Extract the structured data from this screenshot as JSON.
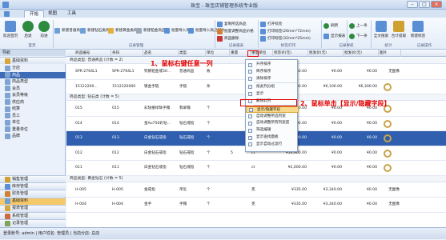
{
  "window": {
    "title": "珠宝 - 珠宝店铺管理系统专业版"
  },
  "tabs": [
    "开始",
    "视图",
    "工具"
  ],
  "ribbon": {
    "big_buttons": [
      {
        "label": "欢迎首页",
        "color": "#5a8fd6"
      },
      {
        "label": "后退",
        "color": "#2e8b3e"
      },
      {
        "label": "前进",
        "color": "#2e8b3e"
      }
    ],
    "buttons": [
      {
        "label": "新建普通商品",
        "color": "#6ea0d8"
      },
      {
        "label": "新建钻石类商品",
        "color": "#6ea0d8"
      },
      {
        "label": "新建黄金类商品",
        "color": "#e0b040"
      },
      {
        "label": "新建铂金商品",
        "color": "#9aa8b8"
      },
      {
        "label": "批量导入商品",
        "color": "#5a8fd6"
      },
      {
        "label": "批量导入商品图片",
        "color": "#5a8fd6"
      },
      {
        "label": "复制所选商品",
        "color": "#5a8fd6"
      },
      {
        "label": "批量调整商品价格",
        "color": "#d08030"
      },
      {
        "label": "商品删除",
        "color": "#cc3333"
      },
      {
        "label": "打开标签",
        "color": "#5a8fd6"
      },
      {
        "label": "打印标签(26mm*72mm)",
        "color": "#5a8fd6"
      },
      {
        "label": "打印标签(32mm*25mm)",
        "color": "#5a8fd6"
      },
      {
        "label": "刷新",
        "color": "#2e8b3e"
      },
      {
        "label": "显示报表",
        "color": "#5a8fd6"
      },
      {
        "label": "上一条",
        "color": "#2e8b3e"
      },
      {
        "label": "下一条",
        "color": "#2e8b3e"
      },
      {
        "label": "全文搜索",
        "color": "#5a8fd6"
      },
      {
        "label": "合计提取",
        "color": "#d0a030"
      },
      {
        "label": "新建标签",
        "color": "#5a8fd6"
      }
    ],
    "groups": [
      "首页",
      "记录管理",
      "记录报表",
      "标签打印",
      "记录导航",
      "统计",
      "记录操作"
    ]
  },
  "nav": {
    "header": "导航",
    "section": "基础资料",
    "items": [
      "分店",
      "商品",
      "商品类型",
      "会员",
      "会员等级",
      "供应商",
      "结算",
      "员工",
      "单位",
      "重量单位",
      "品牌"
    ],
    "selected_index": 1,
    "groups": [
      "销售管理",
      "库存管理",
      "财务管理",
      "基础资料",
      "报表管理",
      "系统管理",
      "记录管理"
    ]
  },
  "grid": {
    "columns": [
      "商品编号",
      "条码",
      "品名",
      "类型",
      "单位",
      "重量",
      "重量单位",
      "标签价(元)",
      "批发价(元)",
      "批发价(元)",
      "图片"
    ],
    "groups": [
      {
        "label": "商品类型: 普通商品 (计数 = 2)",
        "rows": [
          {
            "no": "SPR-2764L1",
            "barcode": "SPR-2764L1",
            "name": "钨钢铂金戒50...",
            "type": "普通商品",
            "unit": "枚",
            "weight": "",
            "wunit": "",
            "tag": "¥150.00",
            "wholesale1": "¥0.00",
            "wholesale2": "¥0.00",
            "pic": "无图像"
          },
          {
            "no": "15122200...",
            "barcode": "1512220000",
            "name": "镀金手链",
            "type": "手链",
            "unit": "条",
            "weight": "",
            "wunit": "",
            "tag": "¥6,300.00",
            "wholesale1": "¥6,100.00",
            "wholesale2": "¥6,300.00",
            "pic": "ring"
          }
        ]
      },
      {
        "label": "商品类型: 钻石类 (计数 = 5)",
        "rows": [
          {
            "no": "015",
            "barcode": "015",
            "name": "彩珐璧绿珠手镯",
            "type": "翡翠镯",
            "unit": "个",
            "weight": "",
            "wunit": "ct",
            "tag": "¥2,400.00",
            "wholesale1": "¥0.00",
            "wholesale2": "¥0.00",
            "pic": "ring"
          },
          {
            "no": "014",
            "barcode": "014",
            "name": "金Au750彩钻...",
            "type": "钻石戒指",
            "unit": "个",
            "weight": "",
            "wunit": "ct",
            "tag": "¥3,000.00",
            "wholesale1": "¥0.00",
            "wholesale2": "¥0.00",
            "pic": "ring"
          },
          {
            "no": "013",
            "barcode": "013",
            "name": "白金钻石戒指",
            "type": "钻石戒指",
            "unit": "个",
            "weight": "",
            "wunit": "ct",
            "tag": "¥2,000.00",
            "wholesale1": "¥0.00",
            "wholesale2": "¥0.00",
            "pic": "ring",
            "selected": true
          },
          {
            "no": "012",
            "barcode": "012",
            "name": "白金钻石戒指",
            "type": "钻石戒指",
            "unit": "个",
            "weight": "5",
            "wunit": "ct",
            "tag": "¥16,900.00",
            "wholesale1": "¥0.00",
            "wholesale2": "¥0.00",
            "pic": "ring"
          },
          {
            "no": "011",
            "barcode": "011",
            "name": "白金钻石戒指",
            "type": "钻石戒指",
            "unit": "个",
            "weight": "",
            "wunit": "ct",
            "tag": "¥2,000.00",
            "wholesale1": "¥0.00",
            "wholesale2": "¥0.00",
            "pic": "ring"
          }
        ]
      },
      {
        "label": "商品类型: 黄金钻石 (计数 = 5)",
        "rows": [
          {
            "no": "H-005",
            "barcode": "H-005",
            "name": "金戒指",
            "type": "吊坠",
            "unit": "个",
            "weight": "",
            "wunit": "克",
            "tag": "¥335.00",
            "wholesale1": "¥3,340.00",
            "wholesale2": "¥0.00",
            "pic": "无图像"
          },
          {
            "no": "H-004",
            "barcode": "H-004",
            "name": "金手",
            "type": "手镯",
            "unit": "个",
            "weight": "",
            "wunit": "克",
            "tag": "¥335.00",
            "wholesale1": "¥3,340.00",
            "wholesale2": "¥0.00",
            "pic": "无图像"
          }
        ]
      }
    ]
  },
  "context_menu": {
    "items": [
      "升序排序",
      "降序排序",
      "清除排序",
      "按此列分组",
      "显示",
      "删除此列",
      "显示/隐藏字段",
      "自动调整所选列宽",
      "自动调整所有列宽度",
      "筛选编辑",
      "显示查找面板",
      "显示自动过滤行"
    ],
    "highlighted_index": 6
  },
  "annotations": {
    "step1": "1、鼠标右键任意一列",
    "step2": "2、鼠标单击【显示/隐藏字段】"
  },
  "status": {
    "text": "登录账号: admin  |  用户姓名: 管理员  |  当前分店: 总店"
  },
  "colors": {
    "accent": "#3d6bb6",
    "annotation": "#e60000"
  }
}
